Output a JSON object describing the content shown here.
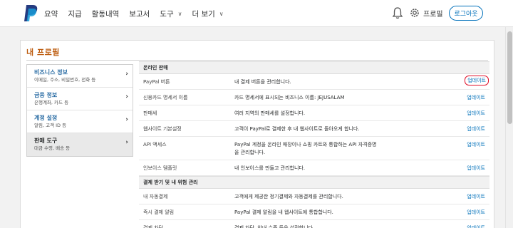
{
  "colors": {
    "brand": "#0070ba",
    "title": "#bd5c0f",
    "link": "#0070ba",
    "highlight": "#e0102a"
  },
  "nav": {
    "items": [
      {
        "label": "요약",
        "has_menu": false
      },
      {
        "label": "지급",
        "has_menu": false
      },
      {
        "label": "활동내역",
        "has_menu": false
      },
      {
        "label": "보고서",
        "has_menu": false
      },
      {
        "label": "도구",
        "has_menu": true
      },
      {
        "label": "더 보기",
        "has_menu": true
      }
    ],
    "icons": [
      "paypal-logo",
      "bell-icon",
      "gear-icon"
    ],
    "profile_label": "프로필",
    "logout_label": "로그아웃"
  },
  "page_title": "내 프로필",
  "sidebar": {
    "items": [
      {
        "title": "비즈니스 정보",
        "subtitle": "이메일, 주소, 비밀번호, 전화 등"
      },
      {
        "title": "금융 정보",
        "subtitle": "은행계좌, 카드 등"
      },
      {
        "title": "계정 설정",
        "subtitle": "알림, 고객 ID 등"
      },
      {
        "title": "판매 도구",
        "subtitle": "대금 수령, 배송 등"
      }
    ],
    "active_index": 3
  },
  "sections": [
    {
      "heading": "온라인 판매",
      "rows": [
        {
          "label": "PayPal 버튼",
          "description": "내 결제 버튼을 관리합니다.",
          "action": "업데이트",
          "highlighted": true
        },
        {
          "label": "신용카드 명세서 이름",
          "description": "카드 명세서에 표시되는 비즈니스 이름: JEJUSALAM",
          "action": "업데이트"
        },
        {
          "label": "판매세",
          "description": "여러 지역의 판매세를 설정합니다.",
          "action": "업데이트"
        },
        {
          "label": "웹사이트 기본설정",
          "description": "고객이 PayPal로 결제한 후 내 웹사이트로 돌아오게 합니다.",
          "action": "업데이트"
        },
        {
          "label": "API 액세스",
          "description": "PayPal 계정을 온라인 매장이나 쇼핑 카트와 통합하는 API 자격증명을 관리합니다.",
          "action": "업데이트"
        },
        {
          "label": "인보이스 템플릿",
          "description": "내 인보이스를 만들고 관리합니다.",
          "action": "업데이트"
        }
      ]
    },
    {
      "heading": "결제 받기 및 내 위험 관리",
      "rows": [
        {
          "label": "내 자동결제",
          "description": "고객에게 제공한 정기결제와 자동결제를 관리합니다.",
          "action": "업데이트"
        },
        {
          "label": "즉시 결제 알림",
          "description": "PayPal 결제 알림을 내 웹사이트에 통합합니다.",
          "action": "업데이트"
        },
        {
          "label": "결제 차단",
          "description": "결제 차단, 안내 수준 등을 설정합니다.",
          "action": "업데이트"
        }
      ]
    }
  ]
}
